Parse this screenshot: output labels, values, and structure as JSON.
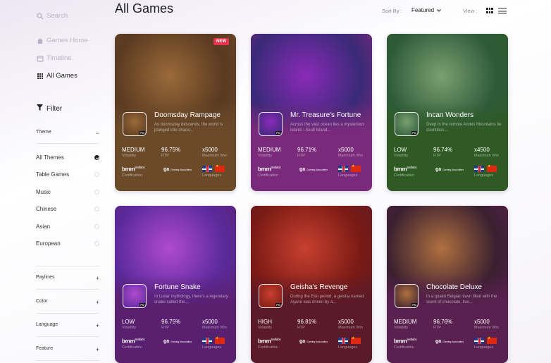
{
  "sidebar": {
    "search_placeholder": "Search",
    "games_home": "Games Home",
    "timeline": "Timeline",
    "all_games": "All Games",
    "filter": "Filter",
    "theme": "Theme",
    "themes": [
      "All Themes",
      "Table Games",
      "Music",
      "Chinese",
      "Asian",
      "European"
    ],
    "selected_theme": "All Themes",
    "sections": [
      "Paylines",
      "Color",
      "Language",
      "Feature"
    ]
  },
  "header": {
    "title": "All Games",
    "sort_label": "Sort By :",
    "sort_value": "Featured",
    "view_label": "View :"
  },
  "labels": {
    "volatility": "Volatility",
    "rtp": "RTP",
    "max_win": "Maximum Win",
    "certification": "Certification",
    "languages": "Languages",
    "cert_logo": "bmm",
    "cert_logo_sub": "testlabs",
    "ga_logo": "ga",
    "ga_sub": "Gaming Associates",
    "pg": "PG"
  },
  "games": [
    {
      "name": "Doomsday Rampage",
      "desc": "As doomsday descends, the world is plunged into chaos...",
      "volatility": "MEDIUM",
      "rtp": "96.75%",
      "max_win": "x5000",
      "badge": "NEW",
      "colors": [
        "#5a3a20",
        "#9a6a3a",
        "#6b4a2a"
      ]
    },
    {
      "name": "Mr. Treasure's Fortune",
      "desc": "Across the vast ocean lies a mysterious island—Skull Island...",
      "volatility": "MEDIUM",
      "rtp": "96.71%",
      "max_win": "x5000",
      "badge": "",
      "colors": [
        "#3a2a78",
        "#8a2ab8",
        "#7a2a7a"
      ]
    },
    {
      "name": "Incan Wonders",
      "desc": "Deep in the remote Andes Mountains lie countless...",
      "volatility": "LOW",
      "rtp": "96.74%",
      "max_win": "x4500",
      "badge": "",
      "colors": [
        "#2e5a3a",
        "#7aa070",
        "#2f5a24"
      ]
    },
    {
      "name": "Fortune Snake",
      "desc": "In Lunar mythology, there's a legendary snake called the...",
      "volatility": "LOW",
      "rtp": "96.75%",
      "max_win": "x5000",
      "badge": "",
      "colors": [
        "#5a2a9a",
        "#b04ad0",
        "#5a2070"
      ]
    },
    {
      "name": "Geisha's Revenge",
      "desc": "During the Edo period, a geisha named Ayane was driven by a...",
      "volatility": "HIGH",
      "rtp": "96.81%",
      "max_win": "x5000",
      "badge": "",
      "colors": [
        "#7a1a14",
        "#c84030",
        "#5a1a2a"
      ]
    },
    {
      "name": "Chocolate Deluxe",
      "desc": "In a quaint Belgian town filled with the scent of chocolate, live...",
      "volatility": "MEDIUM",
      "rtp": "96.76%",
      "max_win": "x5000",
      "badge": "",
      "colors": [
        "#3a2030",
        "#b07040",
        "#5a2050"
      ]
    }
  ]
}
